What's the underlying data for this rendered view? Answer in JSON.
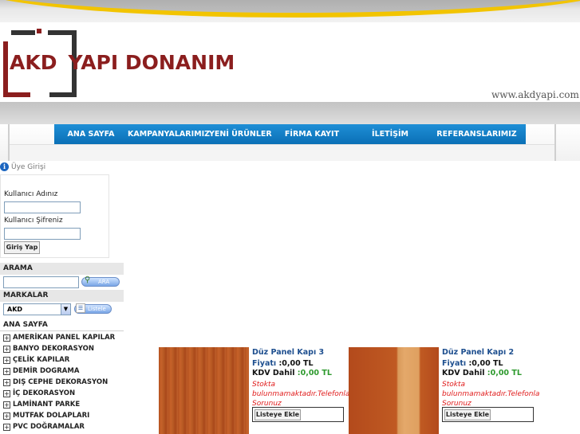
{
  "brand": {
    "logo_akd": "AKD",
    "logo_rest": "YAPI DONANIM",
    "url": "www.akdyapi.com"
  },
  "nav": {
    "items": [
      "ANA SAYFA",
      "KAMPANYALARIMIZ",
      "YENİ ÜRÜNLER",
      "FİRMA KAYIT",
      "İLETİŞİM",
      "REFERANSLARIMIZ"
    ]
  },
  "login": {
    "title": "Üye Girişi",
    "username_label": "Kullanıcı Adınız",
    "password_label": "Kullanıcı Şifreniz",
    "button": "Giriş Yap"
  },
  "search": {
    "title": "ARAMA",
    "button": "ARA"
  },
  "brands": {
    "title": "MARKALAR",
    "selected": "AKD",
    "button": "Listele"
  },
  "categories": {
    "title": "ANA SAYFA",
    "items": [
      "AMERİKAN PANEL KAPILAR",
      "BANYO DEKORASYON",
      "ÇELİK KAPILAR",
      "DEMİR DOGRAMA",
      "DIŞ CEPHE DEKORASYON",
      "İÇ DEKORASYON",
      "LAMİNANT PARKE",
      "MUTFAK DOLAPLARI",
      "PVC DOĞRAMALAR"
    ]
  },
  "products": [
    {
      "title": "Düz Panel Kapı 3",
      "price_label": "Fiyatı",
      "price": ":0,00 TL",
      "kdv_label": "KDV Dahil",
      "kdv_price": ":0,00 TL",
      "stock": "Stokta bulunmamaktadır.Telefonla Sorunuz",
      "button": "Listeye Ekle"
    },
    {
      "title": "Düz Panel Kapı 2",
      "price_label": "Fiyatı",
      "price": ":0,00 TL",
      "kdv_label": "KDV Dahil",
      "kdv_price": ":0,00 TL",
      "stock": "Stokta bulunmamaktadır.Telefonla Sorunuz",
      "button": "Listeye Ekle"
    }
  ],
  "colors": {
    "brand_red": "#8b1e1e",
    "nav_blue": "#0a6fb6",
    "link_blue": "#1e4f8f",
    "kdv_green": "#2e9a2e",
    "stock_red": "#e01b1b",
    "accent_yellow": "#f2c400"
  }
}
